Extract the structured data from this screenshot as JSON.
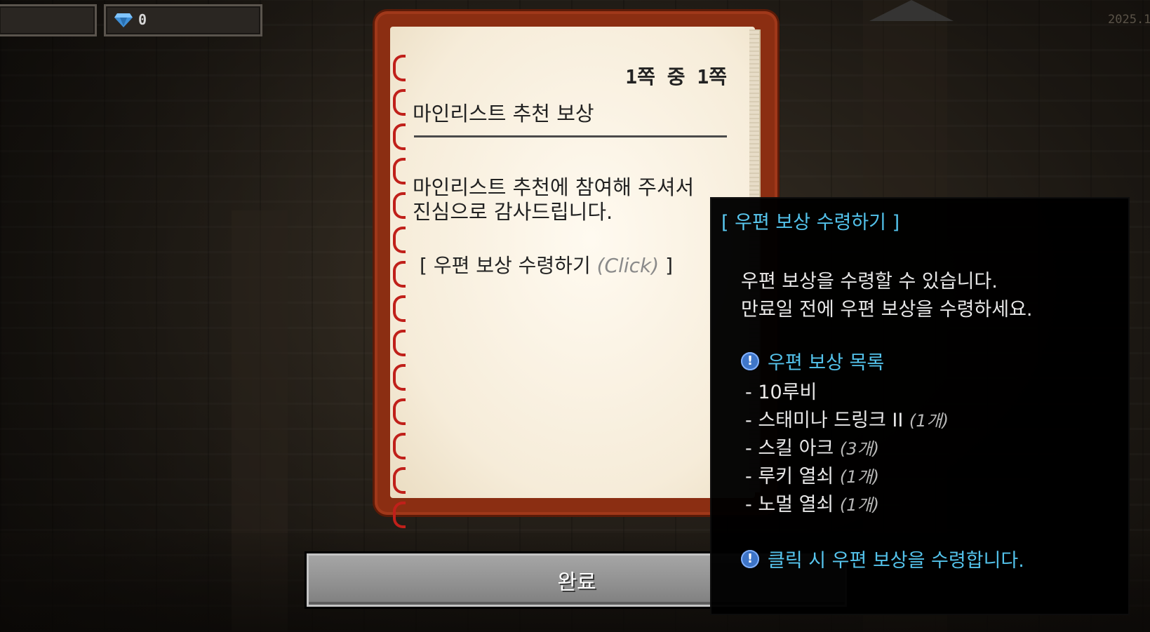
{
  "hud": {
    "gem_value": "0",
    "date_partial": "2025.1"
  },
  "book": {
    "page_indicator": "1쪽 중 1쪽",
    "title": "마인리스트 추천 보상",
    "body_line1": "마인리스트 추천에 참여해 주셔서",
    "body_line2": "진심으로 감사드립니다.",
    "link_open": "[ 우편 보상 수령하기 ",
    "link_click": "(Click)",
    "link_close": " ]"
  },
  "done_button": {
    "label": "완료"
  },
  "tooltip": {
    "title": "[ 우편 보상 수령하기 ]",
    "desc_line1": "우편 보상을 수령할 수 있습니다.",
    "desc_line2": "만료일 전에 우편 보상을 수령하세요.",
    "list_header": "우편 보상 목록",
    "items": [
      {
        "name": "- 10루비",
        "qty": ""
      },
      {
        "name": "- 스태미나 드링크 II ",
        "qty": "(1개)"
      },
      {
        "name": "- 스킬 아크 ",
        "qty": "(3개)"
      },
      {
        "name": "- 루키 열쇠 ",
        "qty": "(1개)"
      },
      {
        "name": "- 노멀 열쇠 ",
        "qty": "(1개)"
      }
    ],
    "footer": "클릭 시 우편 보상을 수령합니다.",
    "accent_color": "#55c8f2"
  }
}
